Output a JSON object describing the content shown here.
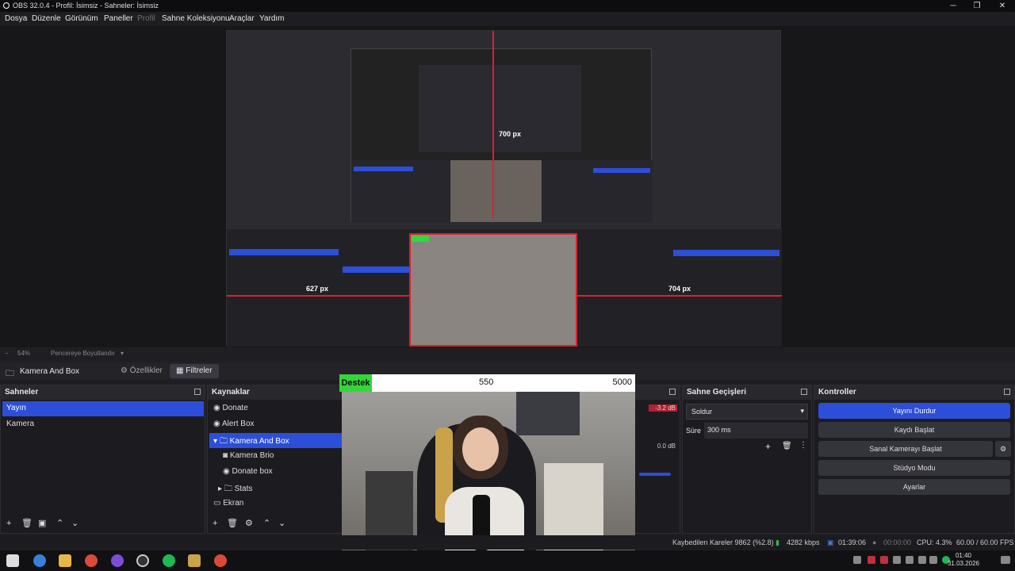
{
  "window": {
    "title": "OBS 32.0.4 - Profil: İsimsiz - Sahneler: İsimsiz",
    "minimize": "─",
    "maximize": "❐",
    "close": "✕"
  },
  "menu": {
    "items": [
      "Dosya",
      "Düzenle",
      "Görünüm",
      "Paneller",
      "Profil",
      "Sahne Koleksiyonu",
      "Araçlar",
      "Yardım"
    ],
    "disabled": [
      "Profil"
    ]
  },
  "preview": {
    "measure_left": "627 px",
    "measure_right": "704 px",
    "measure_center": "700 px",
    "inner_left_label": "627 px",
    "inner_right_label": "704 px"
  },
  "zoom": {
    "value": "54%",
    "mode": "Pencereye Boyutlandır",
    "minus": "−"
  },
  "source_bar": {
    "name": "Kamera And Box",
    "properties": "Özellikler",
    "filters": "Filtreler"
  },
  "scenes": {
    "title": "Sahneler",
    "items": [
      "Yayın",
      "Kamera"
    ],
    "selected": 0
  },
  "sources": {
    "title": "Kaynaklar",
    "items": [
      {
        "label": "Donate",
        "icon": "globe-icon"
      },
      {
        "label": "Alert Box",
        "icon": "globe-icon"
      },
      {
        "label": "Kamera And Box",
        "icon": "folder-icon"
      },
      {
        "label": "Kamera Brio",
        "icon": "camera-icon"
      },
      {
        "label": "Donate box",
        "icon": "globe-icon"
      },
      {
        "label": "Stats",
        "icon": "folder-icon"
      },
      {
        "label": "Ekran",
        "icon": "monitor-icon"
      }
    ]
  },
  "camera_overlay": {
    "left_label": "Destek",
    "mid_value": "550",
    "right_value": "5000"
  },
  "mixer": {
    "db1": "-3.2 dB",
    "db2": "0.0 dB"
  },
  "transitions": {
    "title": "Sahne Geçişleri",
    "type": "Soldur",
    "duration_label": "Süre",
    "duration_value": "300 ms"
  },
  "controls": {
    "title": "Kontroller",
    "buttons": [
      "Yayını Durdur",
      "Kaydı Başlat",
      "Sanal Kamerayı Başlat",
      "Stüdyo Modu",
      "Ayarlar"
    ]
  },
  "status": {
    "dropped": "Kaybedilen Kareler 9862 (%2.8)",
    "bitrate": "4282 kbps",
    "live_time": "01:39:06",
    "rec_time": "00:00:00",
    "cpu": "CPU: 4.3%",
    "fps": "60.00 / 60.00 FPS"
  },
  "clock": {
    "time": "01:40",
    "date": "31.03.2026"
  },
  "colors": {
    "accent": "#2d4ed8",
    "red_guide": "#e01e2a",
    "green": "#34d63a"
  }
}
